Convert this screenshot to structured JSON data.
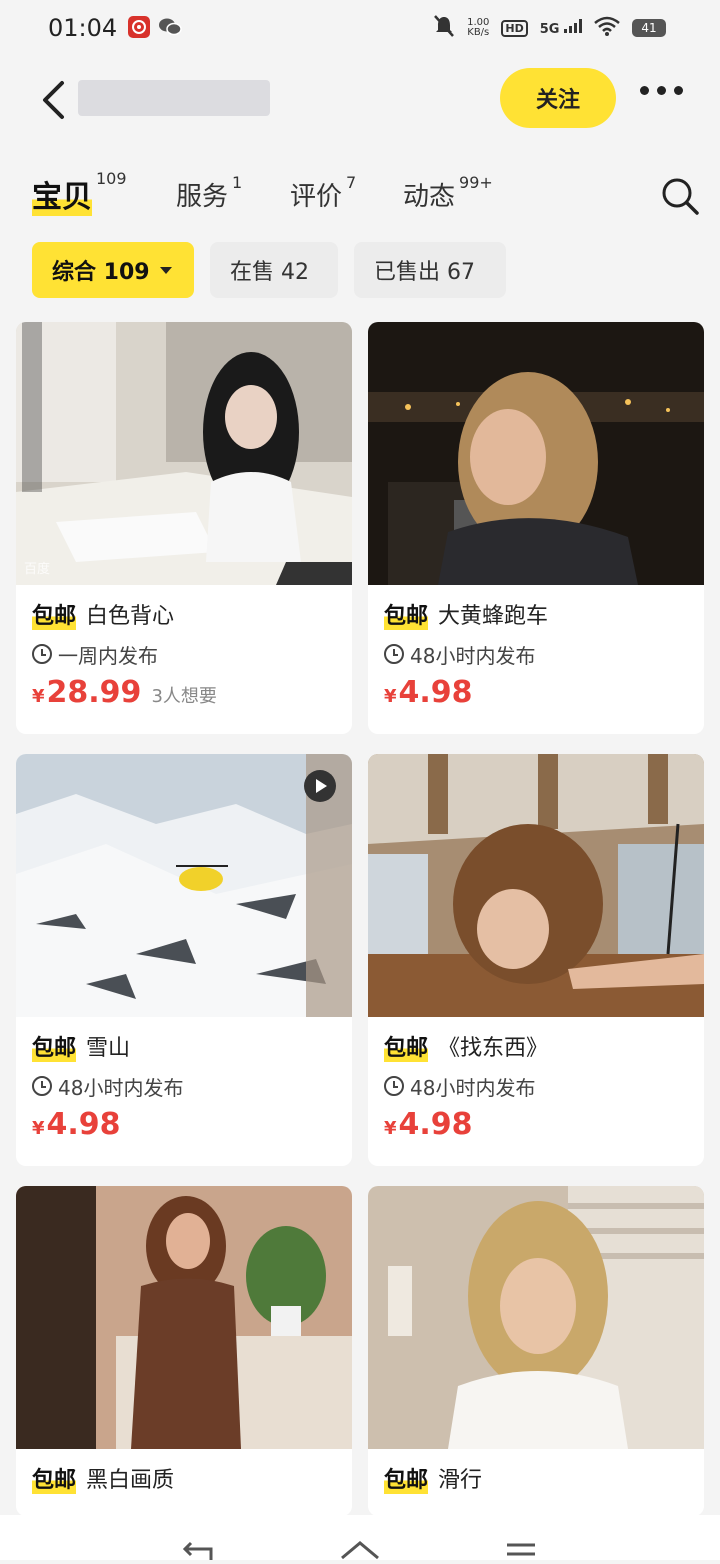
{
  "status_bar": {
    "time": "01:04",
    "network_speed_value": "1.00",
    "network_speed_unit": "KB/s",
    "hd": "HD",
    "signal": "5G",
    "battery": "41",
    "icons": [
      "netease-music-icon",
      "wechat-icon",
      "mute-icon",
      "wifi-icon"
    ]
  },
  "header": {
    "shop_name": "",
    "follow_label": "关注"
  },
  "tabs": [
    {
      "label": "宝贝",
      "count": "109",
      "active": true
    },
    {
      "label": "服务",
      "count": "1",
      "active": false
    },
    {
      "label": "评价",
      "count": "7",
      "active": false
    },
    {
      "label": "动态",
      "count": "99+",
      "active": false
    }
  ],
  "filters": [
    {
      "label": "综合 109",
      "active": true
    },
    {
      "label": "在售 42",
      "active": false
    },
    {
      "label": "已售出 67",
      "active": false
    }
  ],
  "products": [
    {
      "tag": "包邮",
      "title": "白色背心",
      "time": "一周内发布",
      "currency": "¥",
      "price": "28.99",
      "wants": "3人想要",
      "watermark": "百度"
    },
    {
      "tag": "包邮",
      "title": "大黄蜂跑车",
      "time": "48小时内发布",
      "currency": "¥",
      "price": "4.98",
      "wants": ""
    },
    {
      "tag": "包邮",
      "title": "雪山",
      "time": "48小时内发布",
      "currency": "¥",
      "price": "4.98",
      "wants": ""
    },
    {
      "tag": "包邮",
      "title": "《找东西》",
      "time": "48小时内发布",
      "currency": "¥",
      "price": "4.98",
      "wants": ""
    },
    {
      "tag": "包邮",
      "title": "黑白画质"
    },
    {
      "tag": "包邮",
      "title": "滑行"
    }
  ],
  "colors": {
    "accent_yellow": "#ffe234",
    "price_red": "#e8413a",
    "background": "#f4f4f4"
  }
}
